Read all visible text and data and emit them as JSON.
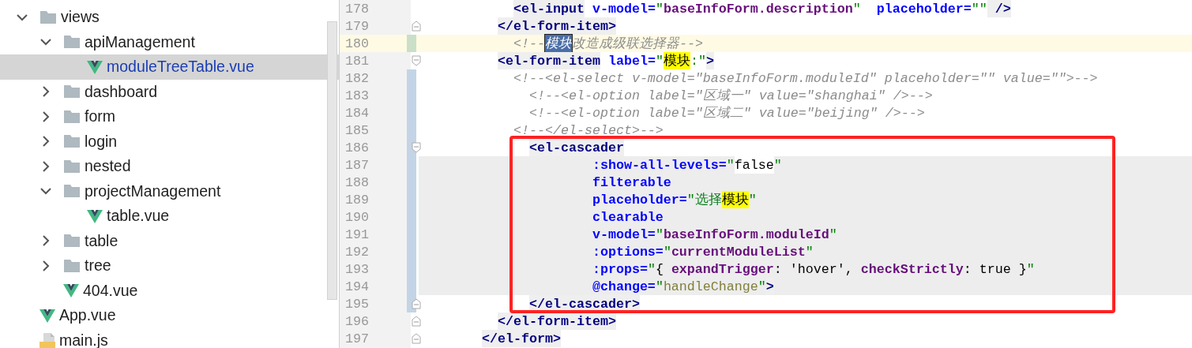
{
  "project_tree": {
    "items": [
      {
        "label": "views",
        "kind": "folder",
        "expanded": true,
        "selected": false,
        "children": [
          {
            "label": "apiManagement",
            "kind": "folder",
            "expanded": true,
            "selected": false,
            "children": [
              {
                "label": "moduleTreeTable.vue",
                "kind": "vue",
                "selected": true
              }
            ]
          },
          {
            "label": "dashboard",
            "kind": "folder",
            "expanded": false,
            "selected": false
          },
          {
            "label": "form",
            "kind": "folder",
            "expanded": false,
            "selected": false
          },
          {
            "label": "login",
            "kind": "folder",
            "expanded": false,
            "selected": false
          },
          {
            "label": "nested",
            "kind": "folder",
            "expanded": false,
            "selected": false
          },
          {
            "label": "projectManagement",
            "kind": "folder",
            "expanded": true,
            "selected": false,
            "children": [
              {
                "label": "table.vue",
                "kind": "vue",
                "selected": false
              }
            ]
          },
          {
            "label": "table",
            "kind": "folder",
            "expanded": false,
            "selected": false
          },
          {
            "label": "tree",
            "kind": "folder",
            "expanded": false,
            "selected": false
          },
          {
            "label": "404.vue",
            "kind": "vue",
            "selected": false
          }
        ]
      },
      {
        "label": "App.vue",
        "kind": "vue",
        "selected": false
      },
      {
        "label": "main.js",
        "kind": "js",
        "selected": false
      }
    ]
  },
  "editor": {
    "callout": {
      "color": "#ff2222"
    },
    "lines": [
      {
        "number": "178",
        "current": false,
        "added": false,
        "modified": false,
        "fold_start": false,
        "fold_end": false,
        "embedded": false,
        "tokens": [
          {
            "kind": "tag",
            "text": "            <el-input"
          },
          {
            "kind": "attr",
            "text": " v-model="
          },
          {
            "kind": "quote",
            "text": "\""
          },
          {
            "kind": "var",
            "text": "baseInfoForm.description"
          },
          {
            "kind": "quote",
            "text": "\""
          },
          {
            "kind": "attr",
            "text": "  placeholder="
          },
          {
            "kind": "quote",
            "text": "\"\""
          },
          {
            "kind": "tag",
            "text": " />"
          }
        ]
      },
      {
        "number": "179",
        "current": false,
        "added": false,
        "modified": false,
        "fold_start": false,
        "fold_end": true,
        "embedded": false,
        "tokens": [
          {
            "kind": "tag",
            "text": "          </el-form-item>"
          }
        ]
      },
      {
        "number": "180",
        "current": true,
        "added": true,
        "modified": false,
        "fold_start": false,
        "fold_end": false,
        "embedded": false,
        "tokens": [
          {
            "kind": "comment",
            "text": "            <!--"
          },
          {
            "kind": "selection",
            "text": "模块"
          },
          {
            "kind": "comment",
            "text": "改造成级联选择器-->"
          }
        ]
      },
      {
        "number": "181",
        "current": false,
        "added": false,
        "modified": false,
        "fold_start": true,
        "fold_end": false,
        "embedded": false,
        "tokens": [
          {
            "kind": "tag",
            "text": "          <el-form-item"
          },
          {
            "kind": "attr",
            "text": " label="
          },
          {
            "kind": "quote",
            "text": "\""
          },
          {
            "kind": "match",
            "text": "模块"
          },
          {
            "kind": "quote",
            "text": ":\""
          },
          {
            "kind": "tag",
            "text": ">"
          }
        ]
      },
      {
        "number": "182",
        "current": false,
        "added": false,
        "modified": true,
        "fold_start": false,
        "fold_end": false,
        "embedded": false,
        "tokens": [
          {
            "kind": "comment",
            "text": "            <!--<el-select v-model=\"baseInfoForm.moduleId\" placeholder=\"\" value=\"\">-->"
          }
        ]
      },
      {
        "number": "183",
        "current": false,
        "added": false,
        "modified": true,
        "fold_start": false,
        "fold_end": false,
        "embedded": false,
        "tokens": [
          {
            "kind": "comment",
            "text": "              <!--<el-option label=\"区域一\" value=\"shanghai\" />-->"
          }
        ]
      },
      {
        "number": "184",
        "current": false,
        "added": false,
        "modified": true,
        "fold_start": false,
        "fold_end": false,
        "embedded": false,
        "tokens": [
          {
            "kind": "comment",
            "text": "              <!--<el-option label=\"区域二\" value=\"beijing\" />-->"
          }
        ]
      },
      {
        "number": "185",
        "current": false,
        "added": false,
        "modified": true,
        "fold_start": false,
        "fold_end": false,
        "embedded": false,
        "tokens": [
          {
            "kind": "comment",
            "text": "            <!--</el-select>-->"
          }
        ]
      },
      {
        "number": "186",
        "current": false,
        "added": false,
        "modified": true,
        "fold_start": true,
        "fold_end": false,
        "embedded": false,
        "tokens": [
          {
            "kind": "tag",
            "text": "              <el-cascader"
          }
        ]
      },
      {
        "number": "187",
        "current": false,
        "added": false,
        "modified": true,
        "fold_start": false,
        "fold_end": false,
        "embedded": true,
        "tokens": [
          {
            "kind": "attr",
            "text": "                      :show-all-levels="
          },
          {
            "kind": "quote",
            "text": "\""
          },
          {
            "kind": "value",
            "text": "false"
          },
          {
            "kind": "quote",
            "text": "\""
          }
        ]
      },
      {
        "number": "188",
        "current": false,
        "added": false,
        "modified": true,
        "fold_start": false,
        "fold_end": false,
        "embedded": true,
        "tokens": [
          {
            "kind": "attr",
            "text": "                      filterable"
          }
        ]
      },
      {
        "number": "189",
        "current": false,
        "added": false,
        "modified": true,
        "fold_start": false,
        "fold_end": false,
        "embedded": true,
        "tokens": [
          {
            "kind": "attr",
            "text": "                      placeholder="
          },
          {
            "kind": "quote",
            "text": "\""
          },
          {
            "kind": "string",
            "text": "选择"
          },
          {
            "kind": "match",
            "text": "模块"
          },
          {
            "kind": "quote",
            "text": "\""
          }
        ]
      },
      {
        "number": "190",
        "current": false,
        "added": false,
        "modified": true,
        "fold_start": false,
        "fold_end": false,
        "embedded": true,
        "tokens": [
          {
            "kind": "attr",
            "text": "                      clearable"
          }
        ]
      },
      {
        "number": "191",
        "current": false,
        "added": false,
        "modified": true,
        "fold_start": false,
        "fold_end": false,
        "embedded": true,
        "tokens": [
          {
            "kind": "attr",
            "text": "                      v-model="
          },
          {
            "kind": "quote",
            "text": "\""
          },
          {
            "kind": "var",
            "text": "baseInfoForm.moduleId"
          },
          {
            "kind": "quote",
            "text": "\""
          }
        ]
      },
      {
        "number": "192",
        "current": false,
        "added": false,
        "modified": true,
        "fold_start": false,
        "fold_end": false,
        "embedded": true,
        "tokens": [
          {
            "kind": "attr",
            "text": "                      :options="
          },
          {
            "kind": "quote",
            "text": "\""
          },
          {
            "kind": "var",
            "text": "currentModuleList"
          },
          {
            "kind": "quote",
            "text": "\""
          }
        ]
      },
      {
        "number": "193",
        "current": false,
        "added": false,
        "modified": true,
        "fold_start": false,
        "fold_end": false,
        "embedded": true,
        "tokens": [
          {
            "kind": "attr",
            "text": "                      :props="
          },
          {
            "kind": "quote",
            "text": "\""
          },
          {
            "kind": "plain",
            "text": "{ "
          },
          {
            "kind": "var",
            "text": "expandTrigger"
          },
          {
            "kind": "plain",
            "text": ": 'hover', "
          },
          {
            "kind": "var",
            "text": "checkStrictly"
          },
          {
            "kind": "plain",
            "text": ": true }"
          },
          {
            "kind": "quote",
            "text": "\""
          }
        ]
      },
      {
        "number": "194",
        "current": false,
        "added": false,
        "modified": true,
        "fold_start": false,
        "fold_end": false,
        "embedded": true,
        "tokens": [
          {
            "kind": "attr",
            "text": "                      @change="
          },
          {
            "kind": "quote",
            "text": "\""
          },
          {
            "kind": "func",
            "text": "handleChange"
          },
          {
            "kind": "quote",
            "text": "\""
          },
          {
            "kind": "tag",
            "text": ">"
          }
        ]
      },
      {
        "number": "195",
        "current": false,
        "added": false,
        "modified": true,
        "fold_start": false,
        "fold_end": true,
        "embedded": false,
        "tokens": [
          {
            "kind": "tag",
            "text": "              </el-cascader>"
          }
        ]
      },
      {
        "number": "196",
        "current": false,
        "added": false,
        "modified": false,
        "fold_start": false,
        "fold_end": true,
        "embedded": false,
        "tokens": [
          {
            "kind": "tag",
            "text": "          </el-form-item>"
          }
        ]
      },
      {
        "number": "197",
        "current": false,
        "added": false,
        "modified": false,
        "fold_start": false,
        "fold_end": true,
        "embedded": false,
        "tokens": [
          {
            "kind": "tag",
            "text": "        </el-form>"
          }
        ]
      }
    ]
  }
}
